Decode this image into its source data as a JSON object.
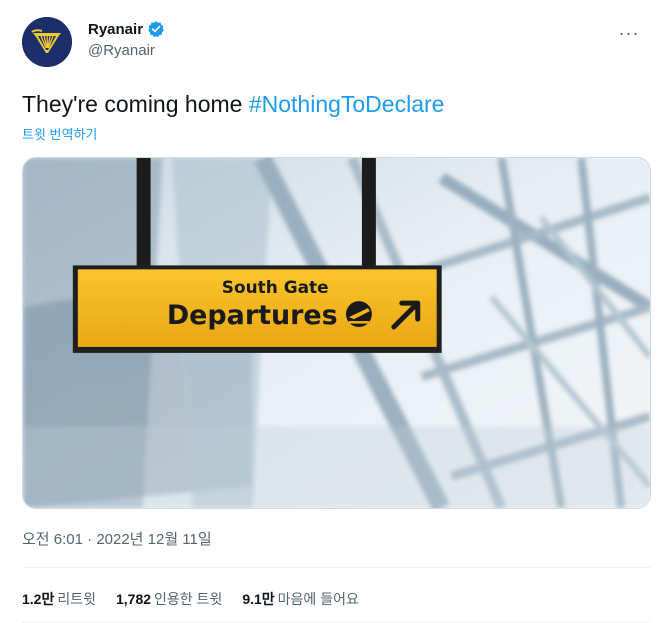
{
  "author": {
    "display_name": "Ryanair",
    "handle": "@Ryanair",
    "verified": true
  },
  "menu": {
    "more_label": "···"
  },
  "tweet": {
    "text": "They're coming home ",
    "hashtag": "#NothingToDeclare",
    "translate_label": "트윗 번역하기"
  },
  "media": {
    "sign_line1": "South Gate",
    "sign_line2": "Departures",
    "sign_color": "#f6b21a"
  },
  "meta": {
    "time": "오전 6:01",
    "separator": "·",
    "date": "2022년 12월 11일"
  },
  "stats": [
    {
      "value": "1.2만",
      "label": "리트윗"
    },
    {
      "value": "1,782",
      "label": "인용한 트윗"
    },
    {
      "value": "9.1만",
      "label": "마음에 들어요"
    }
  ],
  "colors": {
    "link": "#1d9bf0",
    "secondary_text": "#536471",
    "avatar_bg": "#1d2f6b",
    "avatar_logo": "#f1c933"
  }
}
